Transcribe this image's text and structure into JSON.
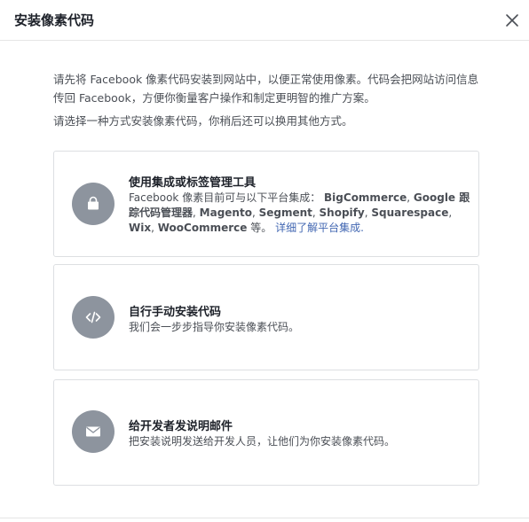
{
  "dialog": {
    "title": "安装像素代码",
    "close_icon": "close-icon"
  },
  "intro": {
    "paragraph": "请先将 Facebook 像素代码安装到网站中，以便正常使用像素。代码会把网站访问信息传回 Facebook，方便你衡量客户操作和制定更明智的推广方案。",
    "instruction": "请选择一种方式安装像素代码，你稍后还可以换用其他方式。"
  },
  "options": [
    {
      "icon": "shopping-bag-icon",
      "title": "使用集成或标签管理工具",
      "desc_prefix": "Facebook 像素目前可与以下平台集成：",
      "platforms": [
        "BigCommerce",
        "Google 跟踪代码管理器",
        "Magento",
        "Segment",
        "Shopify",
        "Squarespace",
        "Wix",
        "WooCommerce"
      ],
      "sep": ", ",
      "suffix": " 等。",
      "link": "详细了解平台集成."
    },
    {
      "icon": "code-icon",
      "title": "自行手动安装代码",
      "desc": "我们会一步步指导你安装像素代码。"
    },
    {
      "icon": "envelope-icon",
      "title": "给开发者发说明邮件",
      "desc": "把安装说明发送给开发人员，让他们为你安装像素代码。"
    }
  ],
  "colors": {
    "icon_circle": "#8d949e",
    "link": "#4267b2",
    "border": "#dddfe2"
  }
}
